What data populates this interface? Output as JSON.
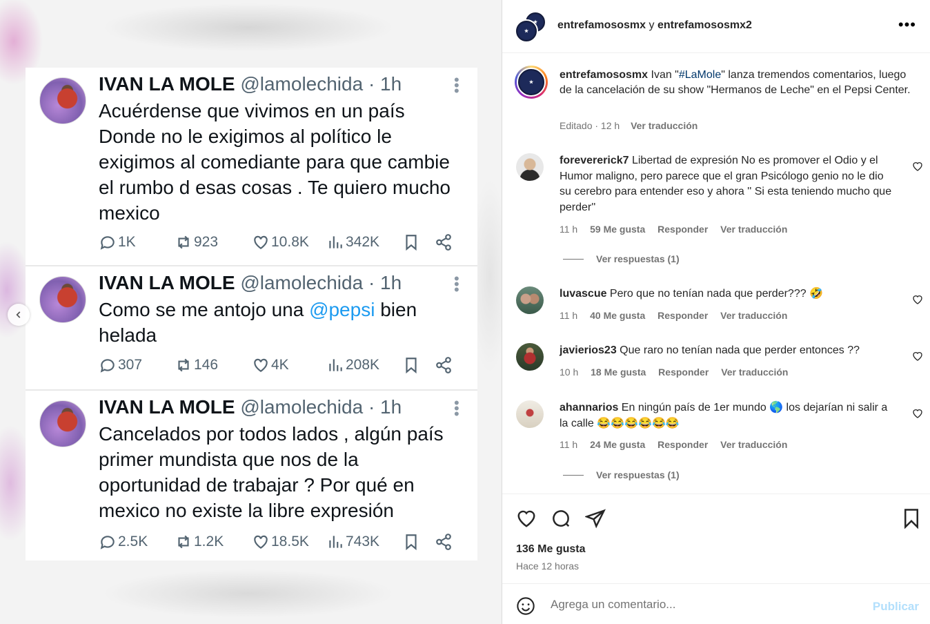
{
  "tweets": [
    {
      "name": "IVAN LA MOLE",
      "handle": "@lamolechida · 1h",
      "text_before": "Acuérdense que vivimos en un país Donde no le exigimos al político le exigimos al comediante para que cambie el rumbo d esas cosas . Te quiero mucho mexico",
      "mention": "",
      "text_after": "",
      "replies": "1K",
      "retweets": "923",
      "likes": "10.8K",
      "views": "342K"
    },
    {
      "name": "IVAN LA MOLE",
      "handle": "@lamolechida · 1h",
      "text_before": "Como se me antojo una ",
      "mention": "@pepsi",
      "text_after": " bien helada",
      "replies": "307",
      "retweets": "146",
      "likes": "4K",
      "views": "208K"
    },
    {
      "name": "IVAN LA MOLE",
      "handle": "@lamolechida · 1h",
      "text_before": "Cancelados por todos lados , algún país primer mundista que nos de la oportunidad de trabajar ? Por qué en mexico no existe la libre expresión",
      "mention": "",
      "text_after": "",
      "replies": "2.5K",
      "retweets": "1.2K",
      "likes": "18.5K",
      "views": "743K"
    }
  ],
  "header": {
    "user1": "entrefamososmx",
    "connector": " y ",
    "user2": "entrefamososmx2",
    "more": "•••"
  },
  "caption": {
    "user": "entrefamososmx",
    "text_before": " Ivan \"",
    "hashtag": "#LaMole",
    "text_after": "\" lanza tremendos comentarios, luego de la cancelación de su show \"Hermanos de Leche\" en el Pepsi Center.",
    "edited": "Editado · 12 h",
    "translate": "Ver traducción"
  },
  "comments": [
    {
      "user": "forevererick7",
      "text": " Libertad de expresión No es promover el Odio y el Humor maligno, pero parece que el gran Psicólogo genio no le dio su cerebro para entender eso y ahora '' Si esta teniendo mucho que perder''",
      "time": "11 h",
      "likes": "59 Me gusta",
      "reply": "Responder",
      "translate": "Ver traducción",
      "view_replies": "Ver respuestas (1)"
    },
    {
      "user": "luvascue",
      "text": " Pero que no tenían nada que perder??? 🤣",
      "time": "11 h",
      "likes": "40 Me gusta",
      "reply": "Responder",
      "translate": "Ver traducción"
    },
    {
      "user": "javierios23",
      "text": " Que raro no tenían nada que perder entonces ??",
      "time": "10 h",
      "likes": "18 Me gusta",
      "reply": "Responder",
      "translate": "Ver traducción"
    },
    {
      "user": "ahannarios",
      "text": " En ningún país de 1er mundo 🌎 los dejarían ni salir a la calle 😂😂😂😂😂😂",
      "time": "11 h",
      "likes": "24 Me gusta",
      "reply": "Responder",
      "translate": "Ver traducción",
      "view_replies": "Ver respuestas (1)"
    }
  ],
  "post": {
    "likes": "136 Me gusta",
    "time": "Hace 12 horas"
  },
  "add_comment": {
    "placeholder": "Agrega un comentario...",
    "publish": "Publicar"
  },
  "colors": {
    "accent_link": "#1d9bf0",
    "publish_disabled": "#b2dffc",
    "hashtag": "#00376b"
  }
}
